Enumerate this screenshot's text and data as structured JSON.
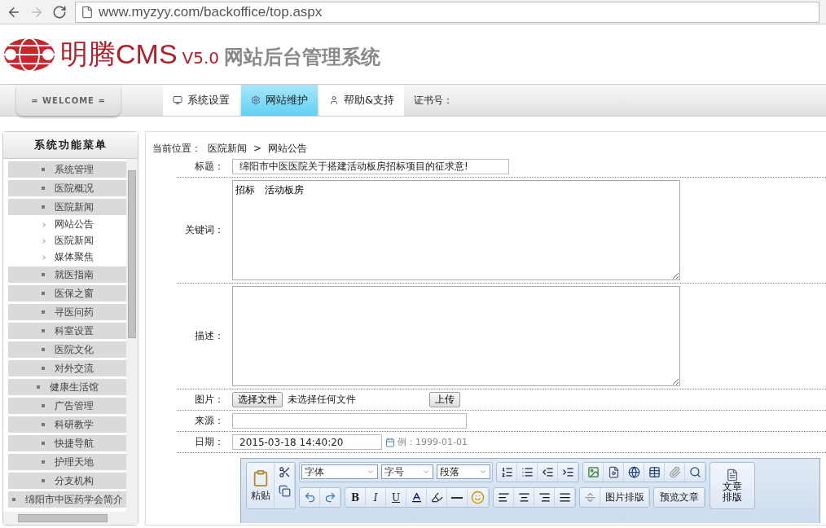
{
  "browser": {
    "url": "www.myzyy.com/backoffice/top.aspx"
  },
  "header": {
    "brand": "明腾CMS",
    "version": "V5.0",
    "subtitle": "网站后台管理系统"
  },
  "nav": {
    "welcome": "= WELCOME =",
    "tabs": [
      {
        "label": "系统设置",
        "selected": false
      },
      {
        "label": "网站维护",
        "selected": true
      },
      {
        "label": "帮助&支持",
        "selected": false
      }
    ],
    "cert_label": "证书号："
  },
  "sidebar": {
    "title": "系统功能菜单",
    "items": [
      {
        "label": "系统管理"
      },
      {
        "label": "医院概况"
      },
      {
        "label": "医院新闻",
        "children": [
          {
            "label": "网站公告"
          },
          {
            "label": "医院新闻"
          },
          {
            "label": "媒体聚焦"
          }
        ]
      },
      {
        "label": "就医指南"
      },
      {
        "label": "医保之窗"
      },
      {
        "label": "寻医问药"
      },
      {
        "label": "科室设置"
      },
      {
        "label": "医院文化"
      },
      {
        "label": "对外交流"
      },
      {
        "label": "健康生活馆"
      },
      {
        "label": "广告管理"
      },
      {
        "label": "科研教学"
      },
      {
        "label": "快捷导航"
      },
      {
        "label": "护理天地"
      },
      {
        "label": "分支机构"
      },
      {
        "label": "绵阳市中医药学会简介"
      }
    ]
  },
  "breadcrumb": {
    "label": "当前位置：",
    "path": [
      "医院新闻",
      "网站公告"
    ],
    "separator": ">"
  },
  "form": {
    "title": {
      "label": "标题：",
      "value": "绵阳市中医医院关于搭建活动板房招标项目的征求意!"
    },
    "keywords": {
      "label": "关键词：",
      "value": "招标　活动板房"
    },
    "description": {
      "label": "描述："
    },
    "picture": {
      "label": "图片：",
      "choose": "选择文件",
      "status": "未选择任何文件",
      "upload": "上传"
    },
    "source": {
      "label": "来源："
    },
    "date": {
      "label": "日期：",
      "value": "2015-03-18 14:40:20",
      "hint": "例：1999-01-01"
    }
  },
  "editor": {
    "paste": "粘贴",
    "selects": [
      "字体",
      "字号",
      "段落"
    ],
    "format_buttons": [
      "B",
      "I",
      "U"
    ],
    "image_layout": "图片排版",
    "preview": "预览文章",
    "article_layout": "文章排版"
  }
}
